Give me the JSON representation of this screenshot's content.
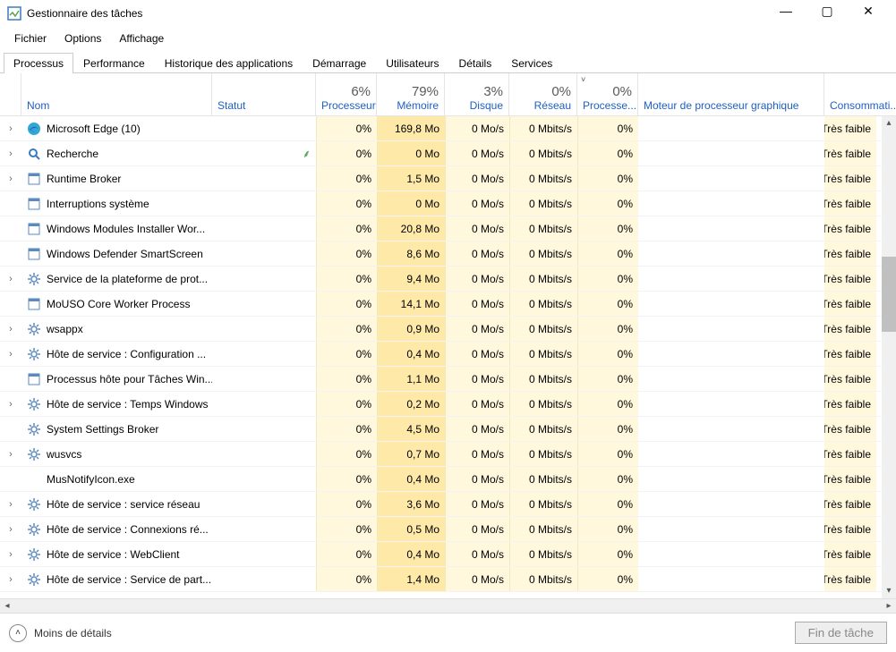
{
  "window": {
    "title": "Gestionnaire des tâches",
    "min": "—",
    "max": "▢",
    "close": "✕"
  },
  "menu": {
    "file": "Fichier",
    "options": "Options",
    "view": "Affichage"
  },
  "tabs": {
    "processes": "Processus",
    "performance": "Performance",
    "apphistory": "Historique des applications",
    "startup": "Démarrage",
    "users": "Utilisateurs",
    "details": "Détails",
    "services": "Services"
  },
  "columns": {
    "name": "Nom",
    "status": "Statut",
    "cpu_pct": "6%",
    "cpu": "Processeur",
    "mem_pct": "79%",
    "mem": "Mémoire",
    "disk_pct": "3%",
    "disk": "Disque",
    "net_pct": "0%",
    "net": "Réseau",
    "gpu_pct": "0%",
    "gpu": "Processe...",
    "gpu_sort": "˅",
    "gpu_engine": "Moteur de processeur graphique",
    "power": "Consommati..."
  },
  "rows": [
    {
      "exp": true,
      "icon": "edge",
      "name": "Microsoft Edge (10)",
      "status": "",
      "cpu": "0%",
      "mem": "169,8 Mo",
      "disk": "0 Mo/s",
      "net": "0 Mbits/s",
      "gpu": "0%",
      "power": "Très faible"
    },
    {
      "exp": true,
      "icon": "search",
      "name": "Recherche",
      "status": "leaf",
      "cpu": "0%",
      "mem": "0 Mo",
      "disk": "0 Mo/s",
      "net": "0 Mbits/s",
      "gpu": "0%",
      "power": "Très faible"
    },
    {
      "exp": true,
      "icon": "app",
      "name": "Runtime Broker",
      "status": "",
      "cpu": "0%",
      "mem": "1,5 Mo",
      "disk": "0 Mo/s",
      "net": "0 Mbits/s",
      "gpu": "0%",
      "power": "Très faible"
    },
    {
      "exp": false,
      "icon": "app",
      "name": "Interruptions système",
      "status": "",
      "cpu": "0%",
      "mem": "0 Mo",
      "disk": "0 Mo/s",
      "net": "0 Mbits/s",
      "gpu": "0%",
      "power": "Très faible"
    },
    {
      "exp": false,
      "icon": "app",
      "name": "Windows Modules Installer Wor...",
      "status": "",
      "cpu": "0%",
      "mem": "20,8 Mo",
      "disk": "0 Mo/s",
      "net": "0 Mbits/s",
      "gpu": "0%",
      "power": "Très faible"
    },
    {
      "exp": false,
      "icon": "app",
      "name": "Windows Defender SmartScreen",
      "status": "",
      "cpu": "0%",
      "mem": "8,6 Mo",
      "disk": "0 Mo/s",
      "net": "0 Mbits/s",
      "gpu": "0%",
      "power": "Très faible"
    },
    {
      "exp": true,
      "icon": "gear",
      "name": "Service de la plateforme de prot...",
      "status": "",
      "cpu": "0%",
      "mem": "9,4 Mo",
      "disk": "0 Mo/s",
      "net": "0 Mbits/s",
      "gpu": "0%",
      "power": "Très faible"
    },
    {
      "exp": false,
      "icon": "app",
      "name": "MoUSO Core Worker Process",
      "status": "",
      "cpu": "0%",
      "mem": "14,1 Mo",
      "disk": "0 Mo/s",
      "net": "0 Mbits/s",
      "gpu": "0%",
      "power": "Très faible"
    },
    {
      "exp": true,
      "icon": "gear",
      "name": "wsappx",
      "status": "",
      "cpu": "0%",
      "mem": "0,9 Mo",
      "disk": "0 Mo/s",
      "net": "0 Mbits/s",
      "gpu": "0%",
      "power": "Très faible"
    },
    {
      "exp": true,
      "icon": "gear",
      "name": "Hôte de service : Configuration ...",
      "status": "",
      "cpu": "0%",
      "mem": "0,4 Mo",
      "disk": "0 Mo/s",
      "net": "0 Mbits/s",
      "gpu": "0%",
      "power": "Très faible"
    },
    {
      "exp": false,
      "icon": "app",
      "name": "Processus hôte pour Tâches Win...",
      "status": "",
      "cpu": "0%",
      "mem": "1,1 Mo",
      "disk": "0 Mo/s",
      "net": "0 Mbits/s",
      "gpu": "0%",
      "power": "Très faible"
    },
    {
      "exp": true,
      "icon": "gear",
      "name": "Hôte de service : Temps Windows",
      "status": "",
      "cpu": "0%",
      "mem": "0,2 Mo",
      "disk": "0 Mo/s",
      "net": "0 Mbits/s",
      "gpu": "0%",
      "power": "Très faible"
    },
    {
      "exp": false,
      "icon": "gear",
      "name": "System Settings Broker",
      "status": "",
      "cpu": "0%",
      "mem": "4,5 Mo",
      "disk": "0 Mo/s",
      "net": "0 Mbits/s",
      "gpu": "0%",
      "power": "Très faible"
    },
    {
      "exp": true,
      "icon": "gear",
      "name": "wusvcs",
      "status": "",
      "cpu": "0%",
      "mem": "0,7 Mo",
      "disk": "0 Mo/s",
      "net": "0 Mbits/s",
      "gpu": "0%",
      "power": "Très faible"
    },
    {
      "exp": false,
      "icon": "none",
      "name": "MusNotifyIcon.exe",
      "status": "",
      "cpu": "0%",
      "mem": "0,4 Mo",
      "disk": "0 Mo/s",
      "net": "0 Mbits/s",
      "gpu": "0%",
      "power": "Très faible"
    },
    {
      "exp": true,
      "icon": "gear",
      "name": "Hôte de service : service réseau",
      "status": "",
      "cpu": "0%",
      "mem": "3,6 Mo",
      "disk": "0 Mo/s",
      "net": "0 Mbits/s",
      "gpu": "0%",
      "power": "Très faible"
    },
    {
      "exp": true,
      "icon": "gear",
      "name": "Hôte de service : Connexions ré...",
      "status": "",
      "cpu": "0%",
      "mem": "0,5 Mo",
      "disk": "0 Mo/s",
      "net": "0 Mbits/s",
      "gpu": "0%",
      "power": "Très faible"
    },
    {
      "exp": true,
      "icon": "gear",
      "name": "Hôte de service : WebClient",
      "status": "",
      "cpu": "0%",
      "mem": "0,4 Mo",
      "disk": "0 Mo/s",
      "net": "0 Mbits/s",
      "gpu": "0%",
      "power": "Très faible"
    },
    {
      "exp": true,
      "icon": "gear",
      "name": "Hôte de service : Service de part...",
      "status": "",
      "cpu": "0%",
      "mem": "1,4 Mo",
      "disk": "0 Mo/s",
      "net": "0 Mbits/s",
      "gpu": "0%",
      "power": "Très faible"
    }
  ],
  "footer": {
    "less": "Moins de détails",
    "chevron": "˄",
    "endtask": "Fin de tâche"
  },
  "icons_svg": {
    "taskmgr": "tm",
    "edge": "ed",
    "search": "se",
    "app": "ap",
    "gear": "ge",
    "none": "no"
  }
}
